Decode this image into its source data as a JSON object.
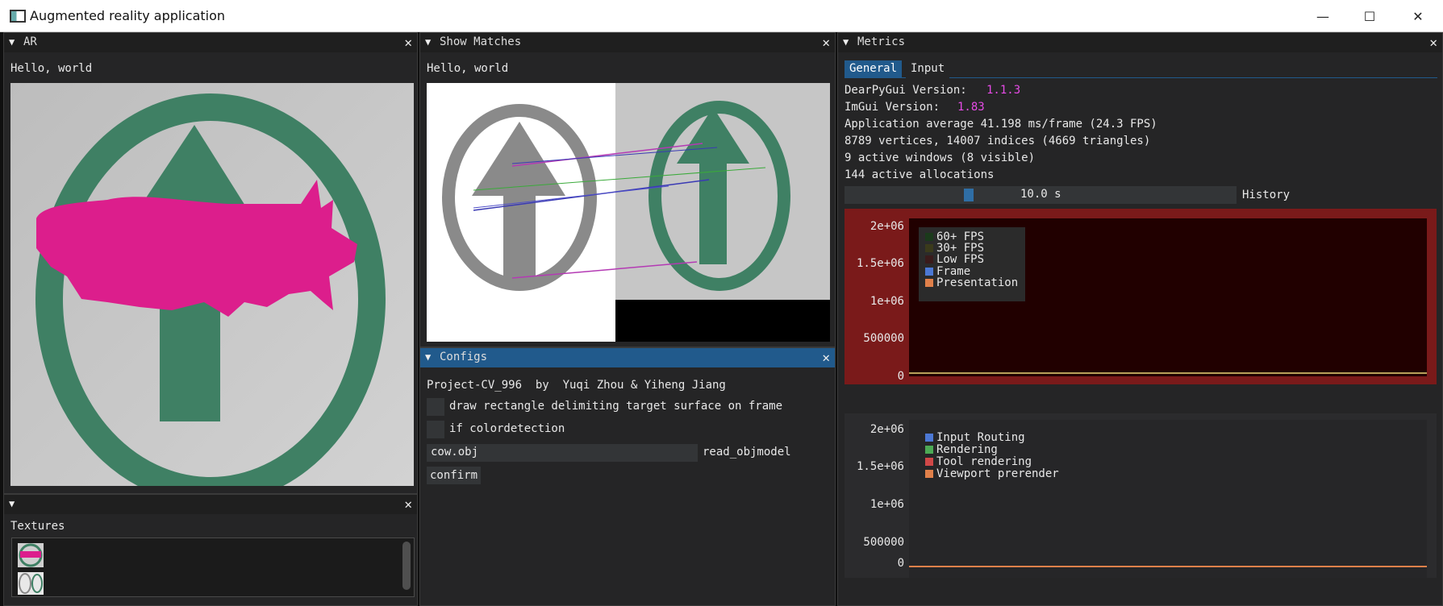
{
  "titlebar": {
    "title": "Augmented reality application"
  },
  "windows": {
    "ar": {
      "title": "AR",
      "hello": "Hello, world"
    },
    "textures": {
      "title": "",
      "label": "Textures"
    },
    "matches": {
      "title": "Show Matches",
      "hello": "Hello, world"
    },
    "configs": {
      "title": "Configs",
      "credits": "Project-CV_996  by  Yuqi Zhou & Yiheng Jiang",
      "checkbox_rect_label": "draw rectangle delimiting target surface on frame",
      "checkbox_color_label": "if colordetection",
      "obj_input_value": "cow.obj",
      "obj_input_label": "read_objmodel",
      "confirm_label": "confirm"
    },
    "metrics": {
      "title": "Metrics",
      "tabs": [
        "General",
        "Input"
      ],
      "dpg_version_label": "DearPyGui Version:",
      "dpg_version": "1.1.3",
      "imgui_version_label": "ImGui Version:",
      "imgui_version": "1.83",
      "app_average": "Application average 41.198 ms/frame (24.3 FPS)",
      "vertices": "8789 vertices, 14007 indices (4669 triangles)",
      "active_windows": "9 active windows (8 visible)",
      "allocations": "144 active allocations",
      "slider_value": "10.0 s",
      "history_label": "History"
    }
  },
  "colors": {
    "accent": "#215a8c",
    "version_magenta": "#e64be6",
    "cow_magenta": "#dc1e8c",
    "sign_green": "#3f8064",
    "plot1_bg": "#7a1a1a",
    "plot1_inner": "#210000"
  },
  "chart_data": [
    {
      "type": "line",
      "yticks": [
        "2e+06",
        "1.5e+06",
        "1e+06",
        "500000",
        "0"
      ],
      "series": [
        {
          "name": "60+ FPS",
          "color": "#1b3a1b"
        },
        {
          "name": "30+ FPS",
          "color": "#3a3a1b"
        },
        {
          "name": "Low FPS",
          "color": "#3a1b1b"
        },
        {
          "name": "Frame",
          "color": "#4c78d4"
        },
        {
          "name": "Presentation",
          "color": "#e0804a"
        }
      ]
    },
    {
      "type": "line",
      "yticks": [
        "2e+06",
        "1.5e+06",
        "1e+06",
        "500000",
        "0"
      ],
      "series": [
        {
          "name": "Input Routing",
          "color": "#4c78d4"
        },
        {
          "name": "Rendering",
          "color": "#4caa55"
        },
        {
          "name": "Tool rendering",
          "color": "#d04848"
        },
        {
          "name": "Viewport prerender",
          "color": "#e0804a"
        }
      ]
    }
  ]
}
